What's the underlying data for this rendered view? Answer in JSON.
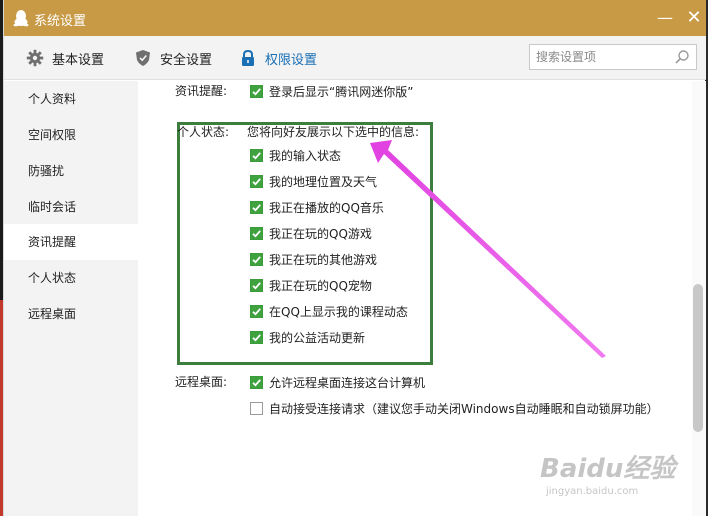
{
  "window": {
    "title": "系统设置",
    "minimize_glyph": "—",
    "close_glyph": "✕"
  },
  "tabs": [
    {
      "label": "基本设置",
      "icon": "gear-icon",
      "active": false
    },
    {
      "label": "安全设置",
      "icon": "shield-icon",
      "active": false
    },
    {
      "label": "权限设置",
      "icon": "lock-icon",
      "active": true
    }
  ],
  "search": {
    "placeholder": "搜索设置项",
    "value": ""
  },
  "sidebar": {
    "items": [
      {
        "label": "个人资料",
        "active": false
      },
      {
        "label": "空间权限",
        "active": false
      },
      {
        "label": "防骚扰",
        "active": false
      },
      {
        "label": "临时会话",
        "active": false
      },
      {
        "label": "资讯提醒",
        "active": true
      },
      {
        "label": "个人状态",
        "active": false
      },
      {
        "label": "远程桌面",
        "active": false
      }
    ]
  },
  "content": {
    "news": {
      "label": "资讯提醒:",
      "option": {
        "label": "登录后显示“腾讯网迷你版”",
        "checked": true
      }
    },
    "status": {
      "label": "个人状态:",
      "intro": "您将向好友展示以下选中的信息:",
      "options": [
        {
          "label": "我的输入状态",
          "checked": true
        },
        {
          "label": "我的地理位置及天气",
          "checked": true
        },
        {
          "label": "我正在播放的QQ音乐",
          "checked": true
        },
        {
          "label": "我正在玩的QQ游戏",
          "checked": true
        },
        {
          "label": "我正在玩的其他游戏",
          "checked": true
        },
        {
          "label": "我正在玩的QQ宠物",
          "checked": true
        },
        {
          "label": "在QQ上显示我的课程动态",
          "checked": true
        },
        {
          "label": "我的公益活动更新",
          "checked": true
        }
      ]
    },
    "remote": {
      "label": "远程桌面:",
      "options": [
        {
          "label": "允许远程桌面连接这台计算机",
          "checked": true
        },
        {
          "label": "自动接受连接请求（建议您手动关闭Windows自动睡眠和自动锁屏功能）",
          "checked": false
        }
      ]
    }
  },
  "annotation": {
    "box_color": "#3d7d3d",
    "arrow_color": "#e040e0"
  },
  "watermark": {
    "brand": "Baidu经验",
    "url": "jingyan.baidu.com"
  },
  "colors": {
    "titlebar": "#c89a46",
    "accent": "#1a6fb5",
    "check": "#3fa23f"
  }
}
